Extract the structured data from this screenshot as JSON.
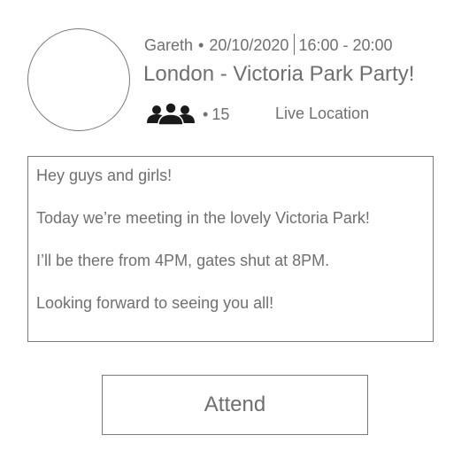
{
  "event": {
    "host": "Gareth",
    "bullet": "•",
    "date": "20/10/2020",
    "time": "16:00 - 20:00",
    "title": "London - Victoria Park Party!",
    "attendee_count": "15",
    "attendee_icon": "people-group-icon",
    "live_location_label": "Live Location"
  },
  "message": {
    "lines": [
      "Hey guys and girls!",
      "Today we’re meeting in the lovely Victoria Park!",
      "I’ll be there from 4PM, gates shut at 8PM.",
      "Looking forward to seeing you all!"
    ]
  },
  "actions": {
    "attend_label": "Attend"
  },
  "colors": {
    "text": "#6f6f6f",
    "border": "#7a7a7a",
    "icon": "#1a1a1a",
    "background": "#ffffff"
  }
}
